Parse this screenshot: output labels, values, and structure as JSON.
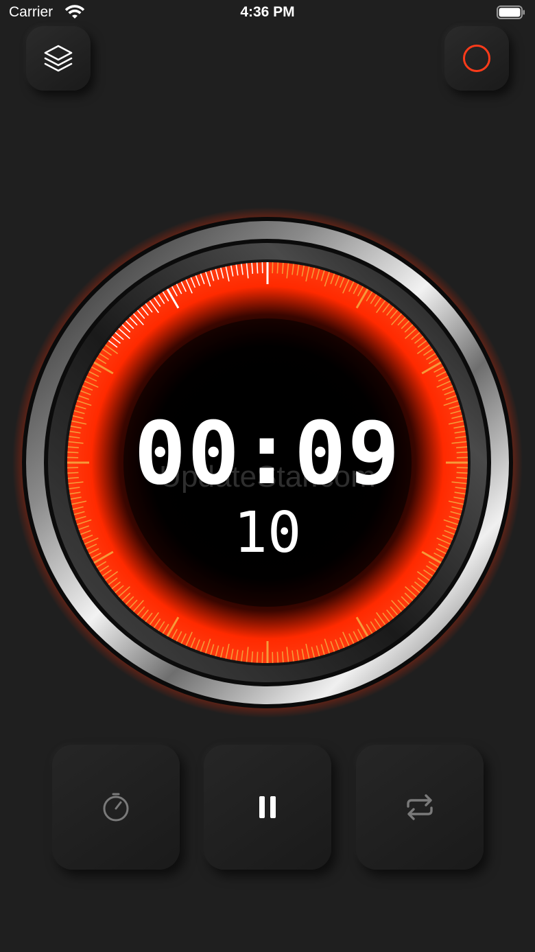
{
  "status_bar": {
    "carrier": "Carrier",
    "time": "4:36 PM"
  },
  "timer": {
    "main": "00:09",
    "sub": "10",
    "progress_seconds": 9,
    "dial_total_seconds": 60
  },
  "watermark": "UpdateStar.com",
  "icons": {
    "layers": "layers-icon",
    "record": "record-icon",
    "stopwatch": "stopwatch-icon",
    "pause": "pause-icon",
    "repeat": "repeat-icon"
  },
  "colors": {
    "background": "#1f1f1f",
    "accent_red": "#ff3b1a",
    "tick_orange": "#f59a3a",
    "tick_white": "#ffffff",
    "record_ring": "#ff3b1a",
    "dim_icon": "#7a7a7a"
  }
}
